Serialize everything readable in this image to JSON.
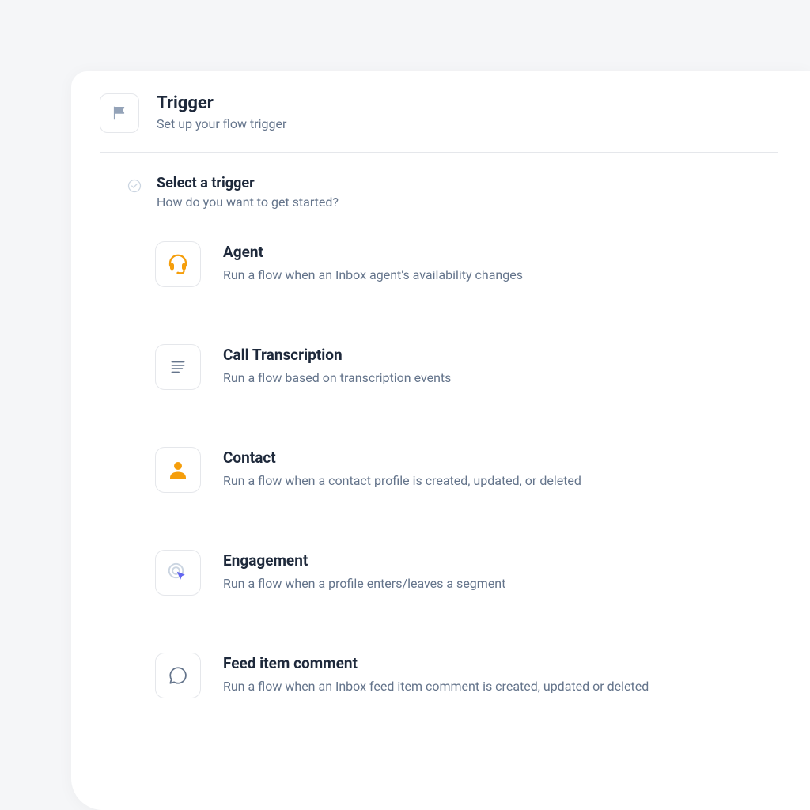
{
  "header": {
    "title": "Trigger",
    "subtitle": "Set up your flow trigger"
  },
  "section": {
    "title": "Select a trigger",
    "subtitle": "How do you want to get started?"
  },
  "options": [
    {
      "title": "Agent",
      "desc": "Run a flow when an Inbox agent's availability changes"
    },
    {
      "title": "Call Transcription",
      "desc": "Run a flow based on transcription events"
    },
    {
      "title": "Contact",
      "desc": "Run a flow when a contact profile is created, updated, or deleted"
    },
    {
      "title": "Engagement",
      "desc": "Run a flow when a profile enters/leaves a segment"
    },
    {
      "title": "Feed item comment",
      "desc": "Run a flow when an Inbox feed item comment is created, updated or deleted"
    }
  ],
  "colors": {
    "orange": "#f59e0b",
    "gray": "#94a3b8",
    "purple": "#6366f1",
    "darkgray": "#64748b"
  }
}
